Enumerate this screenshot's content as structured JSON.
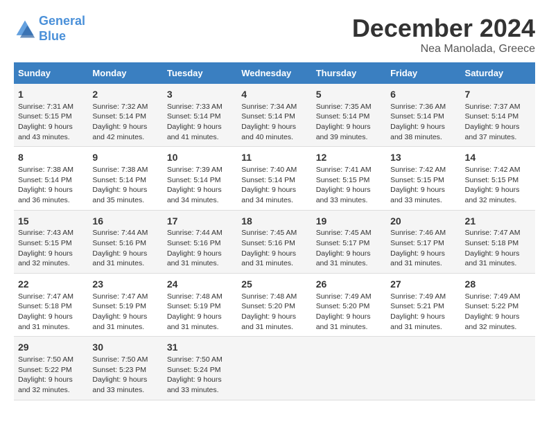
{
  "header": {
    "logo_line1": "General",
    "logo_line2": "Blue",
    "title": "December 2024",
    "subtitle": "Nea Manolada, Greece"
  },
  "days_of_week": [
    "Sunday",
    "Monday",
    "Tuesday",
    "Wednesday",
    "Thursday",
    "Friday",
    "Saturday"
  ],
  "weeks": [
    [
      {
        "day": "1",
        "sunrise": "Sunrise: 7:31 AM",
        "sunset": "Sunset: 5:15 PM",
        "daylight": "Daylight: 9 hours and 43 minutes."
      },
      {
        "day": "2",
        "sunrise": "Sunrise: 7:32 AM",
        "sunset": "Sunset: 5:14 PM",
        "daylight": "Daylight: 9 hours and 42 minutes."
      },
      {
        "day": "3",
        "sunrise": "Sunrise: 7:33 AM",
        "sunset": "Sunset: 5:14 PM",
        "daylight": "Daylight: 9 hours and 41 minutes."
      },
      {
        "day": "4",
        "sunrise": "Sunrise: 7:34 AM",
        "sunset": "Sunset: 5:14 PM",
        "daylight": "Daylight: 9 hours and 40 minutes."
      },
      {
        "day": "5",
        "sunrise": "Sunrise: 7:35 AM",
        "sunset": "Sunset: 5:14 PM",
        "daylight": "Daylight: 9 hours and 39 minutes."
      },
      {
        "day": "6",
        "sunrise": "Sunrise: 7:36 AM",
        "sunset": "Sunset: 5:14 PM",
        "daylight": "Daylight: 9 hours and 38 minutes."
      },
      {
        "day": "7",
        "sunrise": "Sunrise: 7:37 AM",
        "sunset": "Sunset: 5:14 PM",
        "daylight": "Daylight: 9 hours and 37 minutes."
      }
    ],
    [
      {
        "day": "8",
        "sunrise": "Sunrise: 7:38 AM",
        "sunset": "Sunset: 5:14 PM",
        "daylight": "Daylight: 9 hours and 36 minutes."
      },
      {
        "day": "9",
        "sunrise": "Sunrise: 7:38 AM",
        "sunset": "Sunset: 5:14 PM",
        "daylight": "Daylight: 9 hours and 35 minutes."
      },
      {
        "day": "10",
        "sunrise": "Sunrise: 7:39 AM",
        "sunset": "Sunset: 5:14 PM",
        "daylight": "Daylight: 9 hours and 34 minutes."
      },
      {
        "day": "11",
        "sunrise": "Sunrise: 7:40 AM",
        "sunset": "Sunset: 5:14 PM",
        "daylight": "Daylight: 9 hours and 34 minutes."
      },
      {
        "day": "12",
        "sunrise": "Sunrise: 7:41 AM",
        "sunset": "Sunset: 5:15 PM",
        "daylight": "Daylight: 9 hours and 33 minutes."
      },
      {
        "day": "13",
        "sunrise": "Sunrise: 7:42 AM",
        "sunset": "Sunset: 5:15 PM",
        "daylight": "Daylight: 9 hours and 33 minutes."
      },
      {
        "day": "14",
        "sunrise": "Sunrise: 7:42 AM",
        "sunset": "Sunset: 5:15 PM",
        "daylight": "Daylight: 9 hours and 32 minutes."
      }
    ],
    [
      {
        "day": "15",
        "sunrise": "Sunrise: 7:43 AM",
        "sunset": "Sunset: 5:15 PM",
        "daylight": "Daylight: 9 hours and 32 minutes."
      },
      {
        "day": "16",
        "sunrise": "Sunrise: 7:44 AM",
        "sunset": "Sunset: 5:16 PM",
        "daylight": "Daylight: 9 hours and 31 minutes."
      },
      {
        "day": "17",
        "sunrise": "Sunrise: 7:44 AM",
        "sunset": "Sunset: 5:16 PM",
        "daylight": "Daylight: 9 hours and 31 minutes."
      },
      {
        "day": "18",
        "sunrise": "Sunrise: 7:45 AM",
        "sunset": "Sunset: 5:16 PM",
        "daylight": "Daylight: 9 hours and 31 minutes."
      },
      {
        "day": "19",
        "sunrise": "Sunrise: 7:45 AM",
        "sunset": "Sunset: 5:17 PM",
        "daylight": "Daylight: 9 hours and 31 minutes."
      },
      {
        "day": "20",
        "sunrise": "Sunrise: 7:46 AM",
        "sunset": "Sunset: 5:17 PM",
        "daylight": "Daylight: 9 hours and 31 minutes."
      },
      {
        "day": "21",
        "sunrise": "Sunrise: 7:47 AM",
        "sunset": "Sunset: 5:18 PM",
        "daylight": "Daylight: 9 hours and 31 minutes."
      }
    ],
    [
      {
        "day": "22",
        "sunrise": "Sunrise: 7:47 AM",
        "sunset": "Sunset: 5:18 PM",
        "daylight": "Daylight: 9 hours and 31 minutes."
      },
      {
        "day": "23",
        "sunrise": "Sunrise: 7:47 AM",
        "sunset": "Sunset: 5:19 PM",
        "daylight": "Daylight: 9 hours and 31 minutes."
      },
      {
        "day": "24",
        "sunrise": "Sunrise: 7:48 AM",
        "sunset": "Sunset: 5:19 PM",
        "daylight": "Daylight: 9 hours and 31 minutes."
      },
      {
        "day": "25",
        "sunrise": "Sunrise: 7:48 AM",
        "sunset": "Sunset: 5:20 PM",
        "daylight": "Daylight: 9 hours and 31 minutes."
      },
      {
        "day": "26",
        "sunrise": "Sunrise: 7:49 AM",
        "sunset": "Sunset: 5:20 PM",
        "daylight": "Daylight: 9 hours and 31 minutes."
      },
      {
        "day": "27",
        "sunrise": "Sunrise: 7:49 AM",
        "sunset": "Sunset: 5:21 PM",
        "daylight": "Daylight: 9 hours and 31 minutes."
      },
      {
        "day": "28",
        "sunrise": "Sunrise: 7:49 AM",
        "sunset": "Sunset: 5:22 PM",
        "daylight": "Daylight: 9 hours and 32 minutes."
      }
    ],
    [
      {
        "day": "29",
        "sunrise": "Sunrise: 7:50 AM",
        "sunset": "Sunset: 5:22 PM",
        "daylight": "Daylight: 9 hours and 32 minutes."
      },
      {
        "day": "30",
        "sunrise": "Sunrise: 7:50 AM",
        "sunset": "Sunset: 5:23 PM",
        "daylight": "Daylight: 9 hours and 33 minutes."
      },
      {
        "day": "31",
        "sunrise": "Sunrise: 7:50 AM",
        "sunset": "Sunset: 5:24 PM",
        "daylight": "Daylight: 9 hours and 33 minutes."
      },
      null,
      null,
      null,
      null
    ]
  ]
}
